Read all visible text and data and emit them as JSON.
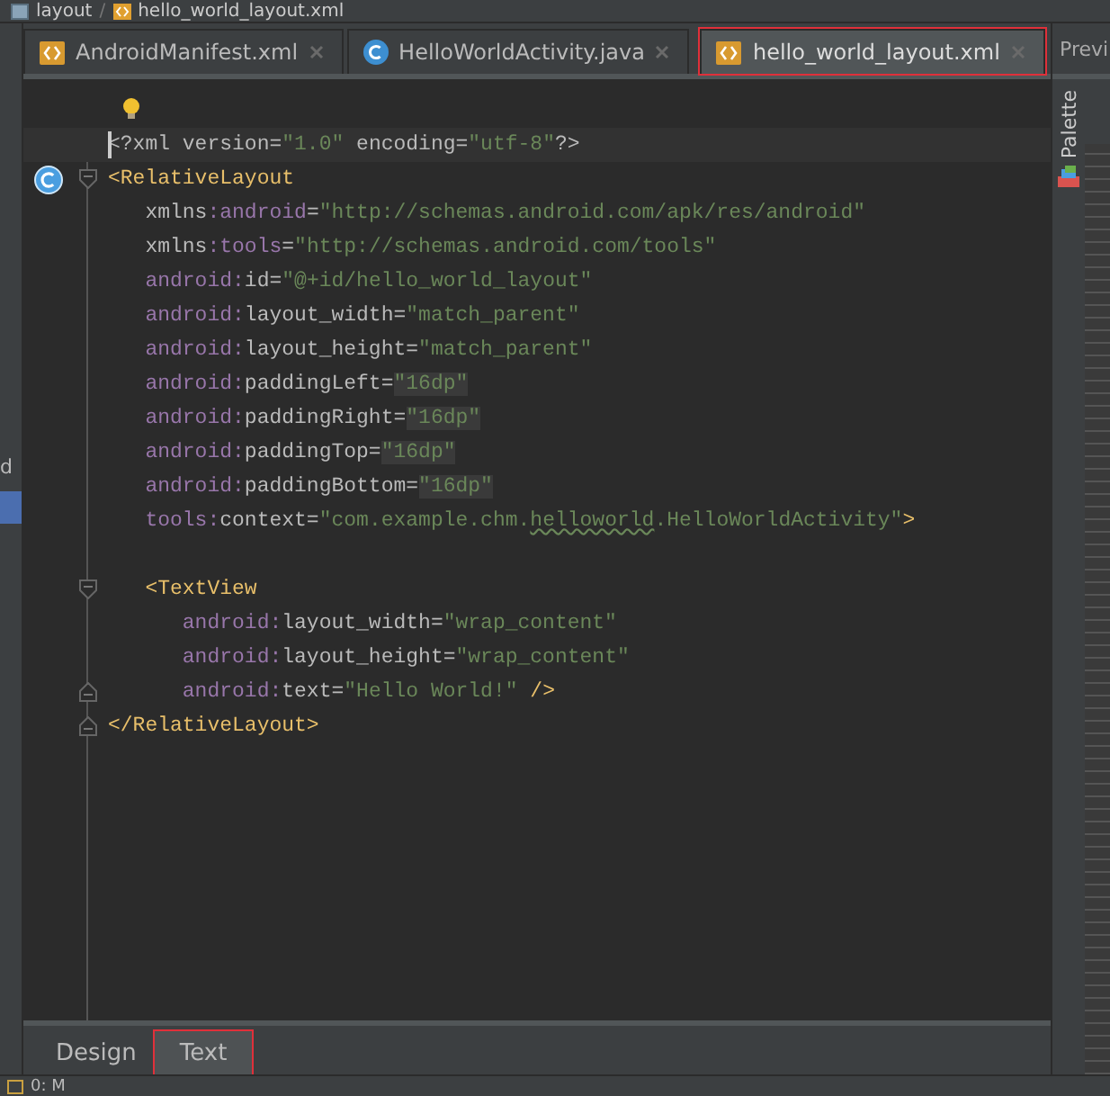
{
  "breadcrumb": {
    "separator": "/",
    "items": [
      {
        "label": "layout",
        "kind": "folder"
      },
      {
        "label": "hello_world_layout.xml",
        "kind": "xml"
      }
    ]
  },
  "tabs": [
    {
      "label": "AndroidManifest.xml",
      "kind": "xml",
      "selected": false,
      "annotated": false
    },
    {
      "label": "HelloWorldActivity.java",
      "kind": "class",
      "selected": false,
      "annotated": false
    },
    {
      "label": "hello_world_layout.xml",
      "kind": "xml",
      "selected": true,
      "annotated": true
    }
  ],
  "left_strip": {
    "label": "d"
  },
  "editor": {
    "lines": [
      {
        "class_marker": false,
        "fold_start": false,
        "fold_end": false,
        "current": true,
        "tokens": [
          {
            "kind": "punct",
            "text": "<?xml version="
          },
          {
            "kind": "value",
            "text": "\"1.0\""
          },
          {
            "kind": "punct",
            "text": " encoding="
          },
          {
            "kind": "value",
            "text": "\"utf-8\""
          },
          {
            "kind": "punct",
            "text": "?>"
          }
        ]
      },
      {
        "class_marker": true,
        "fold_start": true,
        "fold_end": false,
        "current": false,
        "tokens": [
          {
            "kind": "tag",
            "text": "<RelativeLayout"
          }
        ]
      },
      {
        "class_marker": false,
        "fold_start": false,
        "fold_end": false,
        "current": false,
        "tokens": [
          {
            "kind": "plain",
            "text": "   xmlns"
          },
          {
            "kind": "ns",
            "text": ":android"
          },
          {
            "kind": "plain",
            "text": "="
          },
          {
            "kind": "value",
            "text": "\"http://schemas.android.com/apk/res/android\""
          }
        ]
      },
      {
        "class_marker": false,
        "fold_start": false,
        "fold_end": false,
        "current": false,
        "tokens": [
          {
            "kind": "plain",
            "text": "   xmlns"
          },
          {
            "kind": "ns",
            "text": ":tools"
          },
          {
            "kind": "plain",
            "text": "="
          },
          {
            "kind": "value",
            "text": "\"http://schemas.android.com/tools\""
          }
        ]
      },
      {
        "class_marker": false,
        "fold_start": false,
        "fold_end": false,
        "current": false,
        "tokens": [
          {
            "kind": "ns",
            "text": "   android:"
          },
          {
            "kind": "plain",
            "text": "id="
          },
          {
            "kind": "value",
            "text": "\"@+id/hello_world_layout\""
          }
        ]
      },
      {
        "class_marker": false,
        "fold_start": false,
        "fold_end": false,
        "current": false,
        "tokens": [
          {
            "kind": "ns",
            "text": "   android:"
          },
          {
            "kind": "plain",
            "text": "layout_width="
          },
          {
            "kind": "value",
            "text": "\"match_parent\""
          }
        ]
      },
      {
        "class_marker": false,
        "fold_start": false,
        "fold_end": false,
        "current": false,
        "tokens": [
          {
            "kind": "ns",
            "text": "   android:"
          },
          {
            "kind": "plain",
            "text": "layout_height="
          },
          {
            "kind": "value",
            "text": "\"match_parent\""
          }
        ]
      },
      {
        "class_marker": false,
        "fold_start": false,
        "fold_end": false,
        "current": false,
        "tokens": [
          {
            "kind": "ns",
            "text": "   android:"
          },
          {
            "kind": "plain",
            "text": "paddingLeft="
          },
          {
            "kind": "dimen",
            "text": "\"16dp\""
          }
        ]
      },
      {
        "class_marker": false,
        "fold_start": false,
        "fold_end": false,
        "current": false,
        "tokens": [
          {
            "kind": "ns",
            "text": "   android:"
          },
          {
            "kind": "plain",
            "text": "paddingRight="
          },
          {
            "kind": "dimen",
            "text": "\"16dp\""
          }
        ]
      },
      {
        "class_marker": false,
        "fold_start": false,
        "fold_end": false,
        "current": false,
        "tokens": [
          {
            "kind": "ns",
            "text": "   android:"
          },
          {
            "kind": "plain",
            "text": "paddingTop="
          },
          {
            "kind": "dimen",
            "text": "\"16dp\""
          }
        ]
      },
      {
        "class_marker": false,
        "fold_start": false,
        "fold_end": false,
        "current": false,
        "tokens": [
          {
            "kind": "ns",
            "text": "   android:"
          },
          {
            "kind": "plain",
            "text": "paddingBottom="
          },
          {
            "kind": "dimen",
            "text": "\"16dp\""
          }
        ]
      },
      {
        "class_marker": false,
        "fold_start": false,
        "fold_end": false,
        "current": false,
        "tokens": [
          {
            "kind": "ns",
            "text": "   tools:"
          },
          {
            "kind": "plain",
            "text": "context="
          },
          {
            "kind": "value",
            "text": "\"com.example.chm."
          },
          {
            "kind": "typo",
            "text": "helloworld"
          },
          {
            "kind": "value",
            "text": ".HelloWorldActivity\""
          },
          {
            "kind": "tag",
            "text": ">"
          }
        ]
      },
      {
        "class_marker": false,
        "fold_start": false,
        "fold_end": false,
        "current": false
      },
      {
        "class_marker": false,
        "fold_start": true,
        "fold_end": false,
        "current": false,
        "tokens": [
          {
            "kind": "tag",
            "text": "   <TextView"
          }
        ]
      },
      {
        "class_marker": false,
        "fold_start": false,
        "fold_end": false,
        "current": false,
        "tokens": [
          {
            "kind": "ns",
            "text": "      android:"
          },
          {
            "kind": "plain",
            "text": "layout_width="
          },
          {
            "kind": "value",
            "text": "\"wrap_content\""
          }
        ]
      },
      {
        "class_marker": false,
        "fold_start": false,
        "fold_end": false,
        "current": false,
        "tokens": [
          {
            "kind": "ns",
            "text": "      android:"
          },
          {
            "kind": "plain",
            "text": "layout_height="
          },
          {
            "kind": "value",
            "text": "\"wrap_content\""
          }
        ]
      },
      {
        "class_marker": false,
        "fold_start": false,
        "fold_end": true,
        "current": false,
        "tokens": [
          {
            "kind": "ns",
            "text": "      android:"
          },
          {
            "kind": "plain",
            "text": "text="
          },
          {
            "kind": "value",
            "text": "\"Hello World!\""
          },
          {
            "kind": "tag",
            "text": " />"
          }
        ]
      },
      {
        "class_marker": false,
        "fold_start": false,
        "fold_end": true,
        "current": false,
        "tokens": [
          {
            "kind": "tag",
            "text": "</RelativeLayout>"
          }
        ]
      }
    ]
  },
  "right_panel": {
    "header": "Previ",
    "tool": "Palette"
  },
  "bottom_tabs": [
    {
      "label": "Design",
      "selected": false,
      "annotated": false
    },
    {
      "label": "Text",
      "selected": true,
      "annotated": true
    }
  ],
  "status_bar": {
    "label": "0: M"
  }
}
